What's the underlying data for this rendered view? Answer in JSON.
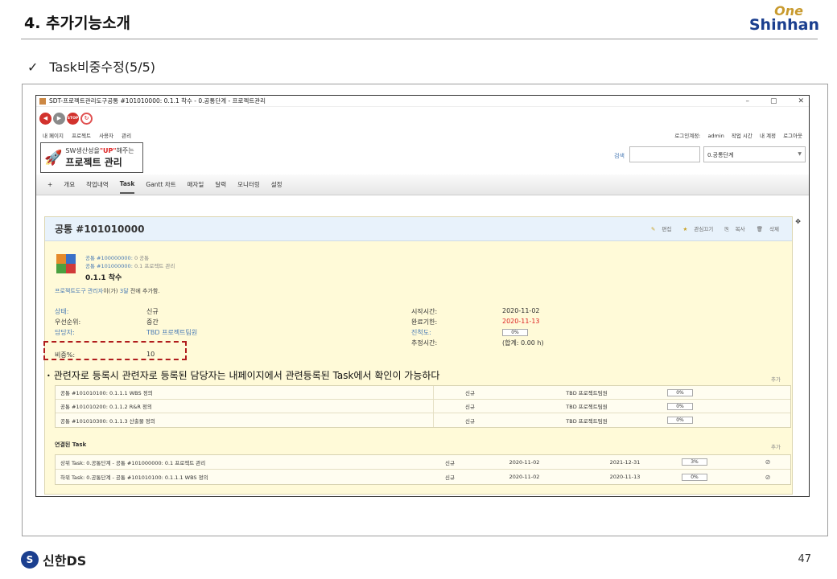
{
  "slide": {
    "title": "4. 추가기능소개",
    "brand_one": "One",
    "brand_name": "Shinhan",
    "subtitle_check": "✓",
    "subtitle": "Task비중수정(5/5)",
    "footer_brand": "신한DS",
    "page_number": "47"
  },
  "window": {
    "title": "SDT-프로젝트관리도구공통 #101010000: 0.1.1 착수 - 0.공통단계 - 프로젝트관리",
    "controls": [
      "–",
      "▢",
      "✕"
    ]
  },
  "browser_buttons": {
    "back": "◀",
    "forward": "▶",
    "stop": "STOP",
    "reload": "↻"
  },
  "top_menu": {
    "left": [
      "내 페이지",
      "프로젝트",
      "사용자",
      "관리"
    ],
    "login_label": "로그인계정:",
    "login_user": "admin",
    "right": [
      "작업 시간",
      "내 계정",
      "로그아웃"
    ]
  },
  "header": {
    "logo_line1_prefix": "SW생산성을",
    "logo_line1_up": "\"UP\"",
    "logo_line1_suffix": "해주는",
    "logo_line2": "프로젝트 관리",
    "search_label": "검색",
    "project_select": "0.공통단계"
  },
  "tabs": [
    "+",
    "개요",
    "작업내역",
    "Task",
    "Gantt 차트",
    "매자일",
    "달력",
    "모니터링",
    "설정"
  ],
  "issue": {
    "title": "공통 #101010000",
    "actions": [
      "편집",
      "관심끄기",
      "복사",
      "삭제"
    ],
    "parents": [
      {
        "link": "공통 #100000000:",
        "text": "0 공통"
      },
      {
        "link": "공통 #101000000:",
        "text": "0.1 프로젝트 관리"
      }
    ],
    "subject": "0.1.1 착수",
    "author_link": "프로젝트도구 관리자",
    "author_mid": "이(가)",
    "author_time": "3달",
    "author_suffix": "전에 추가함.",
    "left_attrs": [
      {
        "label": "상태:",
        "value": "신규"
      },
      {
        "label": "우선순위:",
        "value": "중간"
      },
      {
        "label": "담당자:",
        "value": "TBD 프로젝트팀원"
      },
      {
        "label": "비중%:",
        "value": "10"
      }
    ],
    "right_attrs": [
      {
        "label": "시작시간:",
        "value": "2020-11-02"
      },
      {
        "label": "완료기한:",
        "value": "2020-11-13"
      },
      {
        "label": "진척도:",
        "value": "0%"
      },
      {
        "label": "추정시간:",
        "value": "(합계: 0.00 h)"
      }
    ]
  },
  "note": {
    "bullet": "•",
    "text": "관련자로 등록시  관련자로 등록된 담당자는 내페이지에서 관련등록된 Task에서 확인이 가능하다"
  },
  "subtasks": {
    "add": "추가",
    "rows": [
      {
        "name": "공통 #101010100: 0.1.1.1 WBS 정의",
        "status": "신규",
        "assignee": "TBD 프로젝트팀원",
        "progress": "0%"
      },
      {
        "name": "공통 #101010200: 0.1.1.2 R&R 정의",
        "status": "신규",
        "assignee": "TBD 프로젝트팀원",
        "progress": "0%"
      },
      {
        "name": "공통 #101010300: 0.1.1.3 산출물 정의",
        "status": "신규",
        "assignee": "TBD 프로젝트팀원",
        "progress": "0%"
      }
    ]
  },
  "relations": {
    "title": "연결된 Task",
    "add": "추가",
    "rows": [
      {
        "name": "상위 Task: 0.공통단계 - 공통 #101000000: 0.1 프로젝트 관리",
        "status": "신규",
        "start": "2020-11-02",
        "due": "2021-12-31",
        "progress": "3%"
      },
      {
        "name": "하위 Task: 0.공통단계 - 공통 #101010100: 0.1.1.1 WBS 정의",
        "status": "신규",
        "start": "2020-11-02",
        "due": "2020-11-13",
        "progress": "0%"
      }
    ]
  },
  "colors": {
    "accent_blue": "#1b3f8f",
    "brand_gold": "#c89a2e",
    "highlight_red": "#b01c1c",
    "panel_yellow": "#fffad8"
  }
}
